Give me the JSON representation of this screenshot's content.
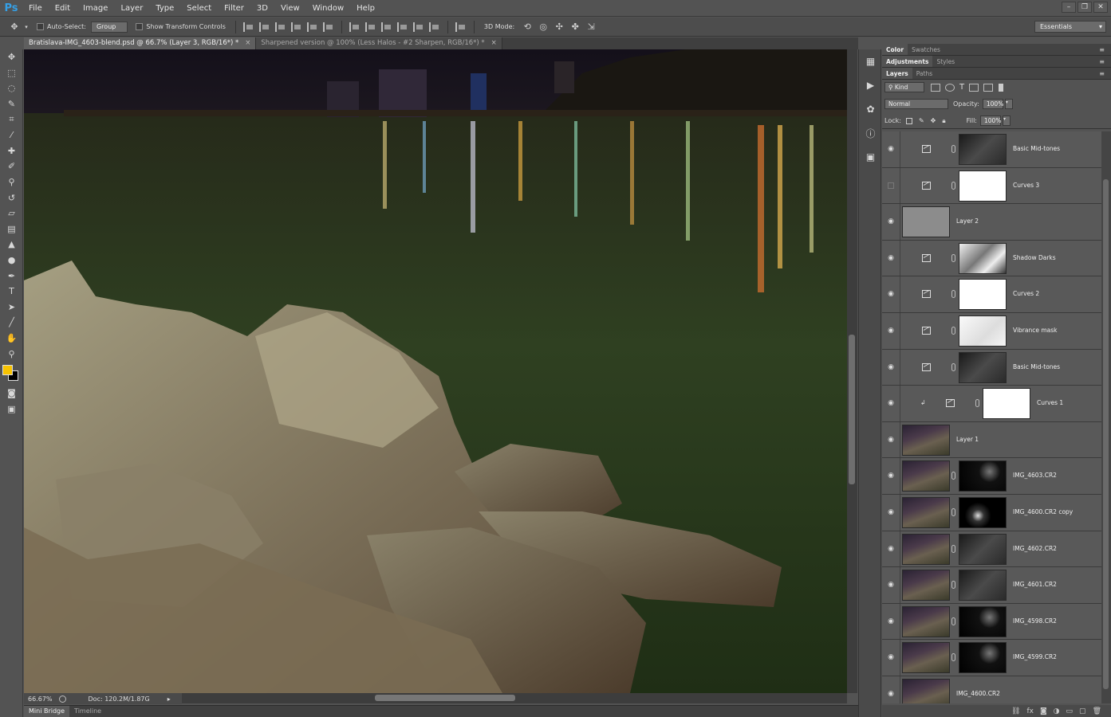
{
  "app": {
    "logo": "Ps"
  },
  "menu": [
    "File",
    "Edit",
    "Image",
    "Layer",
    "Type",
    "Select",
    "Filter",
    "3D",
    "View",
    "Window",
    "Help"
  ],
  "options": {
    "auto_select_label": "Auto-Select:",
    "auto_select_value": "Group",
    "show_transform_label": "Show Transform Controls",
    "mode_3d_label": "3D Mode:",
    "workspace": "Essentials"
  },
  "documents": [
    {
      "title": "Bratislava-IMG_4603-blend.psd @ 66.7% (Layer 3, RGB/16*) *",
      "active": true
    },
    {
      "title": "Sharpened version @ 100% (Less Halos - #2 Sharpen, RGB/16*) *",
      "active": false
    }
  ],
  "colors": {
    "foreground": "#f8c300",
    "background": "#000000",
    "accent": "#35a0e6"
  },
  "status": {
    "zoom": "66.67%",
    "doc_size": "Doc: 120.2M/1.87G"
  },
  "bottom_tabs": [
    "Mini Bridge",
    "Timeline"
  ],
  "panels": {
    "group1": [
      "Color",
      "Swatches"
    ],
    "group2": [
      "Adjustments",
      "Styles"
    ],
    "group3": [
      "Layers",
      "Paths"
    ]
  },
  "layers_controls": {
    "filter_kind": "Kind",
    "blend_mode": "Normal",
    "opacity_label": "Opacity:",
    "opacity_value": "100%",
    "lock_label": "Lock:",
    "fill_label": "Fill:",
    "fill_value": "100%"
  },
  "layers": [
    {
      "name": "Basic Mid-tones",
      "type": "adjustment",
      "visible": true,
      "mask": "dark"
    },
    {
      "name": "Curves 3",
      "type": "adjustment",
      "visible": false,
      "mask": "white"
    },
    {
      "name": "Layer 2",
      "type": "pixel",
      "visible": true,
      "thumb": "gray"
    },
    {
      "name": "Shadow Darks",
      "type": "adjustment",
      "visible": true,
      "mask": "bw"
    },
    {
      "name": "Curves 2",
      "type": "adjustment",
      "visible": true,
      "mask": "white"
    },
    {
      "name": "Vibrance mask",
      "type": "adjustment",
      "visible": true,
      "mask": "light"
    },
    {
      "name": "Basic Mid-tones",
      "type": "adjustment",
      "visible": true,
      "mask": "dark"
    },
    {
      "name": "Curves 1",
      "type": "clipped",
      "visible": true,
      "mask": "white"
    },
    {
      "name": "Layer 1",
      "type": "pixel",
      "visible": true,
      "thumb": "photo"
    },
    {
      "name": "IMG_4603.CR2",
      "type": "masked",
      "visible": true,
      "mask": "black"
    },
    {
      "name": "IMG_4600.CR2 copy",
      "type": "masked",
      "visible": true,
      "mask": "spots"
    },
    {
      "name": "IMG_4602.CR2",
      "type": "masked",
      "visible": true,
      "mask": "dark"
    },
    {
      "name": "IMG_4601.CR2",
      "type": "masked",
      "visible": true,
      "mask": "dark"
    },
    {
      "name": "IMG_4598.CR2",
      "type": "masked",
      "visible": true,
      "mask": "black"
    },
    {
      "name": "IMG_4599.CR2",
      "type": "masked",
      "visible": true,
      "mask": "black"
    },
    {
      "name": "IMG_4600.CR2",
      "type": "pixel",
      "visible": true,
      "thumb": "photo"
    }
  ]
}
